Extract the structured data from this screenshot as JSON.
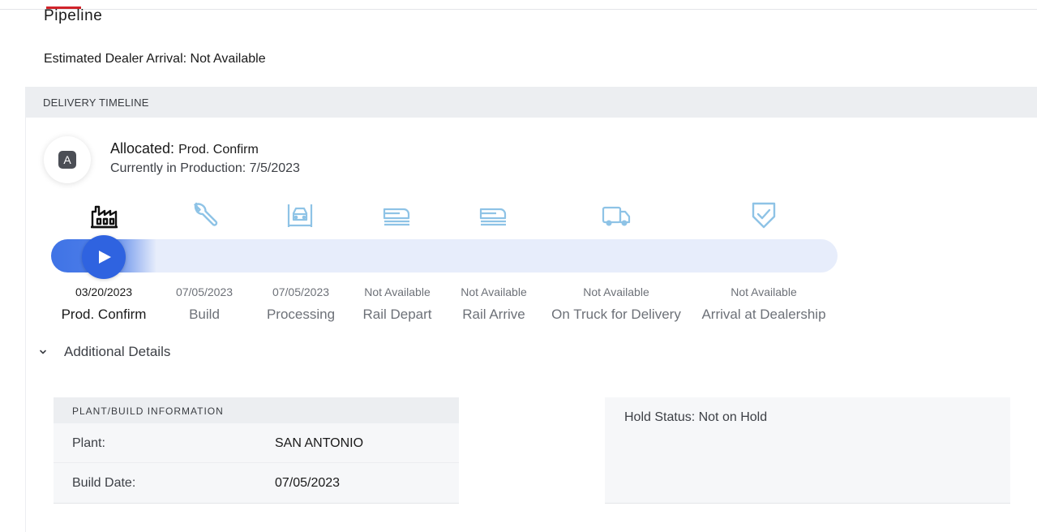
{
  "header": {
    "title": "Pipeline"
  },
  "eta": {
    "text": "Estimated Dealer Arrival: Not Available"
  },
  "timeline": {
    "section_title": "DELIVERY TIMELINE",
    "avatar_letter": "A",
    "status_label": "Allocated:",
    "status_stage": "Prod. Confirm",
    "status_sub": "Currently in Production: 7/5/2023",
    "progress_step": 1,
    "colors": {
      "accent": "#2f63e0",
      "track": "#e7edfb",
      "inactive_icon": "#8ec3e6",
      "brand_red": "#d1232a"
    },
    "steps": [
      {
        "icon": "factory-icon",
        "date": "03/20/2023",
        "label": "Prod. Confirm"
      },
      {
        "icon": "wrench-icon",
        "date": "07/05/2023",
        "label": "Build"
      },
      {
        "icon": "vehicle-processing-icon",
        "date": "07/05/2023",
        "label": "Processing"
      },
      {
        "icon": "rail-depart-icon",
        "date": "Not Available",
        "label": "Rail Depart"
      },
      {
        "icon": "rail-arrive-icon",
        "date": "Not Available",
        "label": "Rail Arrive"
      },
      {
        "icon": "truck-icon",
        "date": "Not Available",
        "label": "On Truck for Delivery"
      },
      {
        "icon": "shield-check-icon",
        "date": "Not Available",
        "label": "Arrival at Dealership"
      }
    ]
  },
  "details": {
    "toggle_label": "Additional Details",
    "plant_card": {
      "title": "PLANT/BUILD INFORMATION",
      "rows": [
        {
          "key": "Plant:",
          "value": "SAN ANTONIO"
        },
        {
          "key": "Build Date:",
          "value": "07/05/2023"
        }
      ]
    },
    "hold_status": "Hold Status: Not on Hold"
  }
}
